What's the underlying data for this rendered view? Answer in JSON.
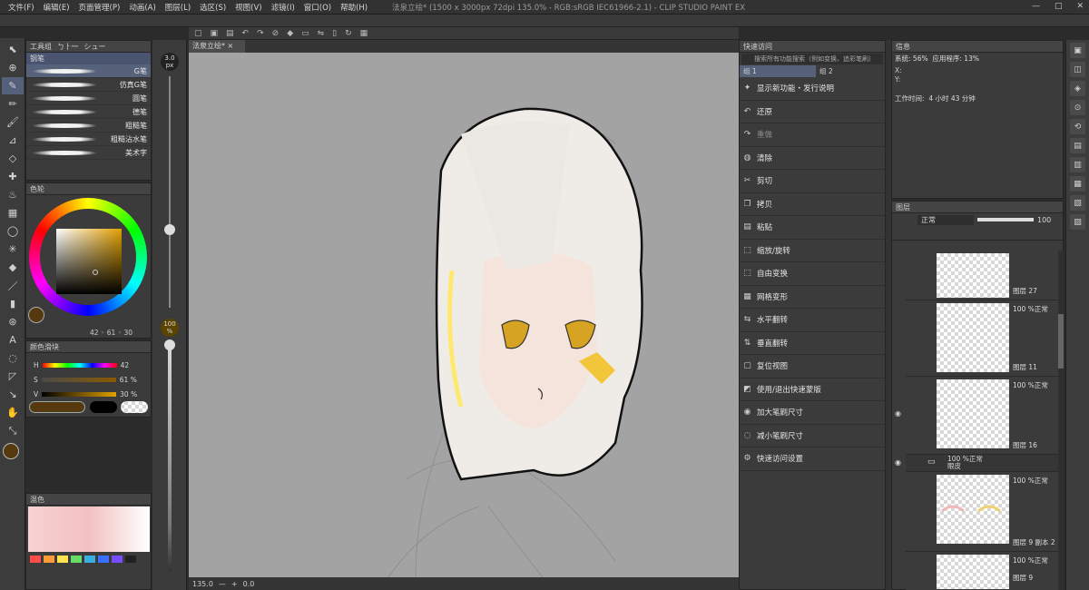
{
  "menu": [
    "文件(F)",
    "编辑(E)",
    "页面管理(P)",
    "动画(A)",
    "图层(L)",
    "选区(S)",
    "视图(V)",
    "滤镜(I)",
    "窗口(O)",
    "帮助(H)"
  ],
  "window": {
    "title": "法泉立绘* (1500 x 3000px 72dpi 135.0% - RGB:sRGB IEC61966-2.1) - CLIP STUDIO PAINT EX",
    "min": "—",
    "max": "□",
    "close": "✕"
  },
  "toolpanel": {
    "tabs": [
      "工具组",
      "ㄅㅏ㆒",
      "シュー"
    ],
    "subtab": "钢笔",
    "brushes": [
      "G笔",
      "仿真G笔",
      "圆笔",
      "德笔",
      "粗糙笔",
      "粗糙沾水笔",
      "美术字"
    ]
  },
  "color_panel": {
    "title": "色轮",
    "h": "42",
    "s": "61",
    "v": "30",
    "main_color": "#56390f"
  },
  "slider_panel": {
    "title": "颜色滑块",
    "labels": {
      "h": "H",
      "s": "S",
      "v": "V"
    },
    "values": {
      "h": "42",
      "s": "61 %",
      "v": "30 %"
    }
  },
  "mix_panel": {
    "tab": "混色",
    "palette": [
      "#ff4a4a",
      "#ff9a3a",
      "#ffe34a",
      "#66dd66",
      "#3ab0e0",
      "#3a70ff",
      "#7a4aff",
      "#222222"
    ]
  },
  "brush_size": {
    "value": "3.0",
    "unit": "px"
  },
  "opacity": {
    "value": "100",
    "unit": "%"
  },
  "canvas": {
    "tab": "法泉立绘*",
    "zoom": "135.0",
    "rotation": "0.0"
  },
  "quick_access": {
    "title": "快速访问",
    "search_placeholder": "搜索所有功能搜索（例如变换、追彩笔刷）",
    "groups": [
      "组 1",
      "组 2"
    ],
    "items": [
      {
        "icon": "sparkle-icon",
        "label": "显示新功能・发行说明",
        "dim": false
      },
      {
        "icon": "undo-icon",
        "label": "还原",
        "dim": false
      },
      {
        "icon": "redo-icon",
        "label": "重做",
        "dim": true
      },
      {
        "icon": "erase-icon",
        "label": "清除",
        "dim": false
      },
      {
        "icon": "cut-icon",
        "label": "剪切",
        "dim": false
      },
      {
        "icon": "copy-icon",
        "label": "拷贝",
        "dim": false
      },
      {
        "icon": "paste-icon",
        "label": "粘贴",
        "dim": false
      },
      {
        "icon": "scale-icon",
        "label": "缩放/旋转",
        "dim": false
      },
      {
        "icon": "transform-icon",
        "label": "自由变换",
        "dim": false
      },
      {
        "icon": "mesh-icon",
        "label": "网格变形",
        "dim": false
      },
      {
        "icon": "flip-h-icon",
        "label": "水平翻转",
        "dim": false
      },
      {
        "icon": "flip-v-icon",
        "label": "垂直翻转",
        "dim": false
      },
      {
        "icon": "reset-view-icon",
        "label": "复位视图",
        "dim": false
      },
      {
        "icon": "quickmask-icon",
        "label": "使用/退出快速蒙版",
        "dim": false
      },
      {
        "icon": "brush-plus-icon",
        "label": "加大笔刷尺寸",
        "dim": false
      },
      {
        "icon": "brush-minus-icon",
        "label": "减小笔刷尺寸",
        "dim": false
      },
      {
        "icon": "settings-icon",
        "label": "快速访问设置",
        "dim": false
      }
    ]
  },
  "info_panel": {
    "tab": "信息",
    "system_label": "系统:",
    "system_val": "56%",
    "app_label": "应用程序:",
    "app_val": "13%",
    "x": "X:",
    "y": "Y:",
    "work_label": "工作时间:",
    "work_val": "4 小时 43 分钟"
  },
  "layers": {
    "tab": "图层",
    "blend": "正常",
    "opacity": "100",
    "rows": [
      {
        "mode": "",
        "name": "图层 27"
      },
      {
        "mode": "100 %正常",
        "name": "图层 11"
      },
      {
        "mode": "100 %正常",
        "name": "图层 16"
      },
      {
        "mode": "100 %正常",
        "name": "图层 9 副本 2"
      },
      {
        "mode": "100 %正常",
        "name": "图层 9"
      }
    ],
    "folder": {
      "mode": "100 %正常",
      "name": "眼皮"
    }
  }
}
